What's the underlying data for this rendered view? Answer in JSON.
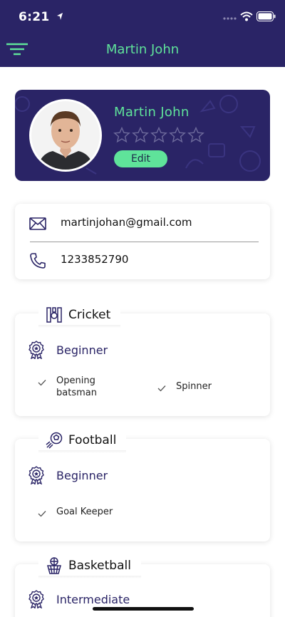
{
  "status_bar": {
    "time": "6:21",
    "location_icon": "location-arrow-icon",
    "signal_icon": "signal-dots-icon",
    "wifi_icon": "wifi-icon",
    "battery_icon": "battery-icon"
  },
  "nav": {
    "menu_icon": "filter-menu-icon",
    "title": "Martin John"
  },
  "profile": {
    "name": "Martin John",
    "rating": 0,
    "rating_max": 5,
    "edit_label": "Edit"
  },
  "contact": {
    "email": "martinjohan@gmail.com",
    "phone": "1233852790",
    "email_icon": "envelope-icon",
    "phone_icon": "phone-icon"
  },
  "sports": [
    {
      "name": "Cricket",
      "icon": "cricket-icon",
      "level": "Beginner",
      "skills": [
        "Opening batsman",
        "Spinner"
      ]
    },
    {
      "name": "Football",
      "icon": "football-icon",
      "level": "Beginner",
      "skills": [
        "Goal Keeper"
      ]
    },
    {
      "name": "Basketball",
      "icon": "basketball-icon",
      "level": "Intermediate",
      "skills": []
    }
  ],
  "colors": {
    "primary": "#2a2466",
    "accent": "#5fe39a",
    "background": "#ffffff"
  }
}
